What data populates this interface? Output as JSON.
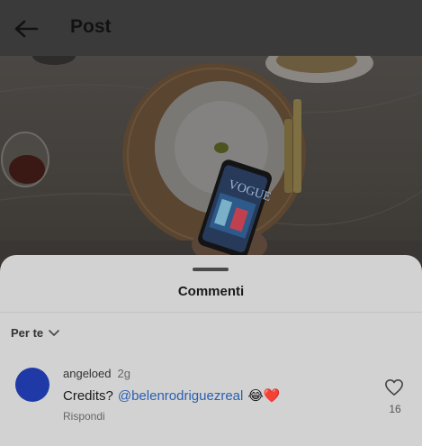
{
  "header": {
    "title": "Post"
  },
  "sheet": {
    "title": "Commenti",
    "filter_label": "Per te"
  },
  "comment": {
    "username": "angeloed",
    "time": "2g",
    "text_prefix": "Credits?",
    "mention": "@belenrodriguezreal",
    "emojis": "😂❤️",
    "reply_label": "Rispondi",
    "like_count": "16"
  },
  "icons": {
    "back": "arrow-left-icon",
    "chevron": "chevron-down-icon",
    "like": "heart-outline-icon"
  },
  "colors": {
    "avatar": "#1f3aa6",
    "mention": "#2a5fb0",
    "sheet_bg": "#d2d2d2"
  }
}
